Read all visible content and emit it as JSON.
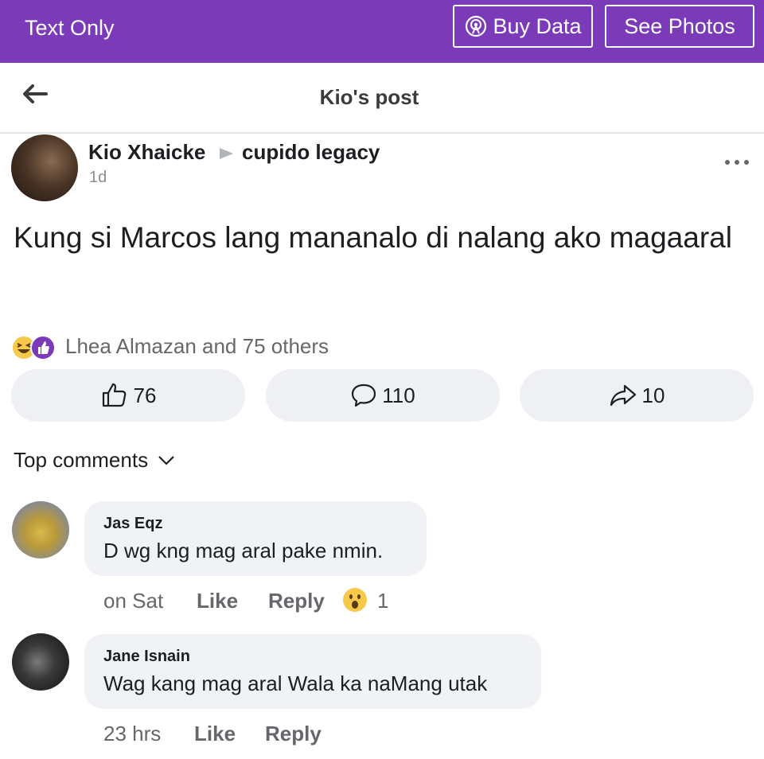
{
  "topbar": {
    "text_only": "Text Only",
    "buy_data": "Buy Data",
    "see_photos": "See Photos",
    "color": "#7b3ab8"
  },
  "header": {
    "title": "Kio's post"
  },
  "post": {
    "author": "Kio Xhaicke",
    "group": "cupido legacy",
    "time": "1d",
    "text": "Kung si Marcos lang mananalo di nalang ako magaaral",
    "reactions_summary": "Lhea Almazan and 75 others",
    "reaction_icons": [
      "haha-icon",
      "like-icon"
    ],
    "likes": "76",
    "comments": "110",
    "shares": "10"
  },
  "comments_section": {
    "filter_label": "Top comments"
  },
  "comments": [
    {
      "name": "Jas Eqz",
      "text": "D wg kng mag aral pake nmin.",
      "time": "on Sat",
      "like": "Like",
      "reply": "Reply",
      "reaction_icon": "wow-icon",
      "reaction_count": "1"
    },
    {
      "name": "Jane Isnain",
      "text": "Wag kang mag aral Wala ka naMang utak",
      "time": "23 hrs",
      "like": "Like",
      "reply": "Reply"
    }
  ]
}
